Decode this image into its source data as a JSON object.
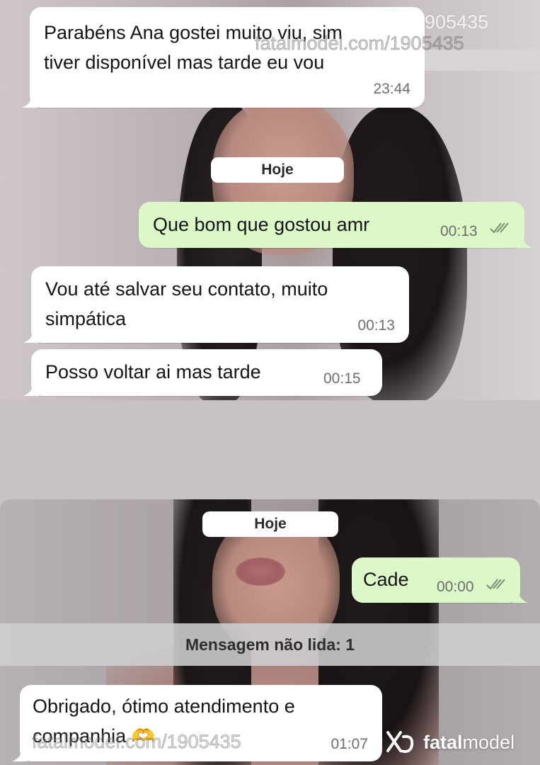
{
  "top_screenshot": {
    "messages": [
      {
        "text": "Parabéns Ana gostei muito viu, sim\ntiver disponível mas tarde eu vou",
        "time": "23:44"
      },
      {
        "text": "Que bom que gostou  amr",
        "time": "00:13"
      },
      {
        "text": "Vou até salvar seu contato, muito\nsimpática",
        "time": "00:13"
      },
      {
        "text": "Posso voltar ai mas tarde",
        "time": "00:15"
      }
    ],
    "date_chip": "Hoje"
  },
  "bottom_screenshot": {
    "date_chip": "Hoje",
    "messages": [
      {
        "text": "Cade",
        "time": "00:00"
      },
      {
        "text": "Obrigado, ótimo atendimento e\ncompanhia 🫶",
        "time": "01:07"
      }
    ],
    "unread_banner": "Mensagem não lida: 1"
  },
  "watermarks": {
    "top_right": "905435",
    "top_line": "fatalmodel.com/1905435",
    "bottom_line": "fatalmodel.com/1905435",
    "brand_part_a": "fatal",
    "brand_part_b": "model"
  },
  "colors": {
    "incoming_bubble": "#ffffff",
    "outgoing_bubble": "#dcf8c6",
    "read_ticks": "#7a8a7a",
    "timestamp": "#6e6e6e"
  },
  "icons": {
    "read_receipt": "double-check-icon",
    "brand_logo": "fatalmodel-logo-icon"
  }
}
